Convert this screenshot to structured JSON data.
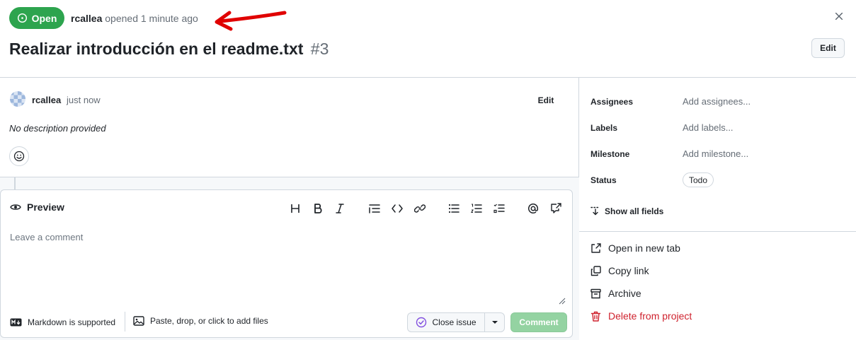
{
  "header": {
    "state_label": "Open",
    "author": "rcallea",
    "opened_text": "opened 1 minute ago",
    "title": "Realizar introducción en el readme.txt",
    "number": "#3",
    "edit_label": "Edit",
    "close_icon": "close-icon"
  },
  "comment": {
    "author": "rcallea",
    "time": "just now",
    "edit_label": "Edit",
    "body": "No description provided"
  },
  "editor": {
    "preview_label": "Preview",
    "placeholder": "Leave a comment",
    "markdown_note": "Markdown is supported",
    "attach_label": "Paste, drop, or click to add files",
    "close_issue_label": "Close issue",
    "comment_label": "Comment",
    "toolbar_icons": [
      "heading-icon",
      "bold-icon",
      "italic-icon",
      "quote-icon",
      "code-icon",
      "link-icon",
      "bullet-list-icon",
      "numbered-list-icon",
      "task-list-icon",
      "mention-icon",
      "reference-icon"
    ]
  },
  "sidebar": {
    "fields": [
      {
        "label": "Assignees",
        "value": "Add assignees..."
      },
      {
        "label": "Labels",
        "value": "Add labels..."
      },
      {
        "label": "Milestone",
        "value": "Add milestone..."
      },
      {
        "label": "Status",
        "value": "Todo"
      }
    ],
    "show_all": "Show all fields",
    "actions": [
      {
        "label": "Open in new tab",
        "icon": "external-link-icon"
      },
      {
        "label": "Copy link",
        "icon": "copy-icon"
      },
      {
        "label": "Archive",
        "icon": "archive-icon"
      },
      {
        "label": "Delete from project",
        "icon": "trash-icon"
      }
    ]
  },
  "colors": {
    "open_green": "#2da44e",
    "comment_button_disabled": "#94d3a2",
    "danger": "#cf222e",
    "annotation_arrow": "#e00000"
  }
}
